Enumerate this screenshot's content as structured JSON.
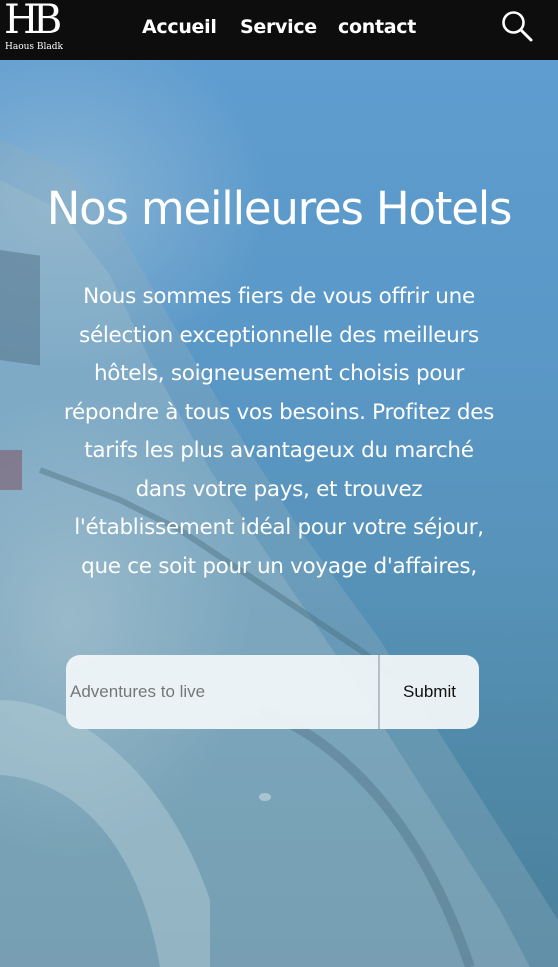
{
  "brand": {
    "logo_mark": "HB",
    "logo_text": "Haous Bladk"
  },
  "nav": {
    "items": [
      {
        "label": "Accueil"
      },
      {
        "label": "Service"
      },
      {
        "label": "contact"
      }
    ],
    "search_icon": "search-icon"
  },
  "hero": {
    "title": "Nos meilleures Hotels",
    "description": "Nous sommes fiers de vous offrir une sélection exceptionnelle des meilleurs hôtels, soigneusement choisis pour répondre à tous vos besoins. Profitez des tarifs les plus avantageux du marché dans votre pays, et trouvez l'établissement idéal pour votre séjour, que ce soit pour un voyage d'affaires,"
  },
  "search_form": {
    "placeholder": "Adventures to live",
    "value": "",
    "submit_label": "Submit"
  },
  "colors": {
    "navbar": "#0d0d0d",
    "hero_top": "#5f9dd0",
    "hero_bottom": "#4a7f9a",
    "form_bg": "#f0f5f8"
  }
}
